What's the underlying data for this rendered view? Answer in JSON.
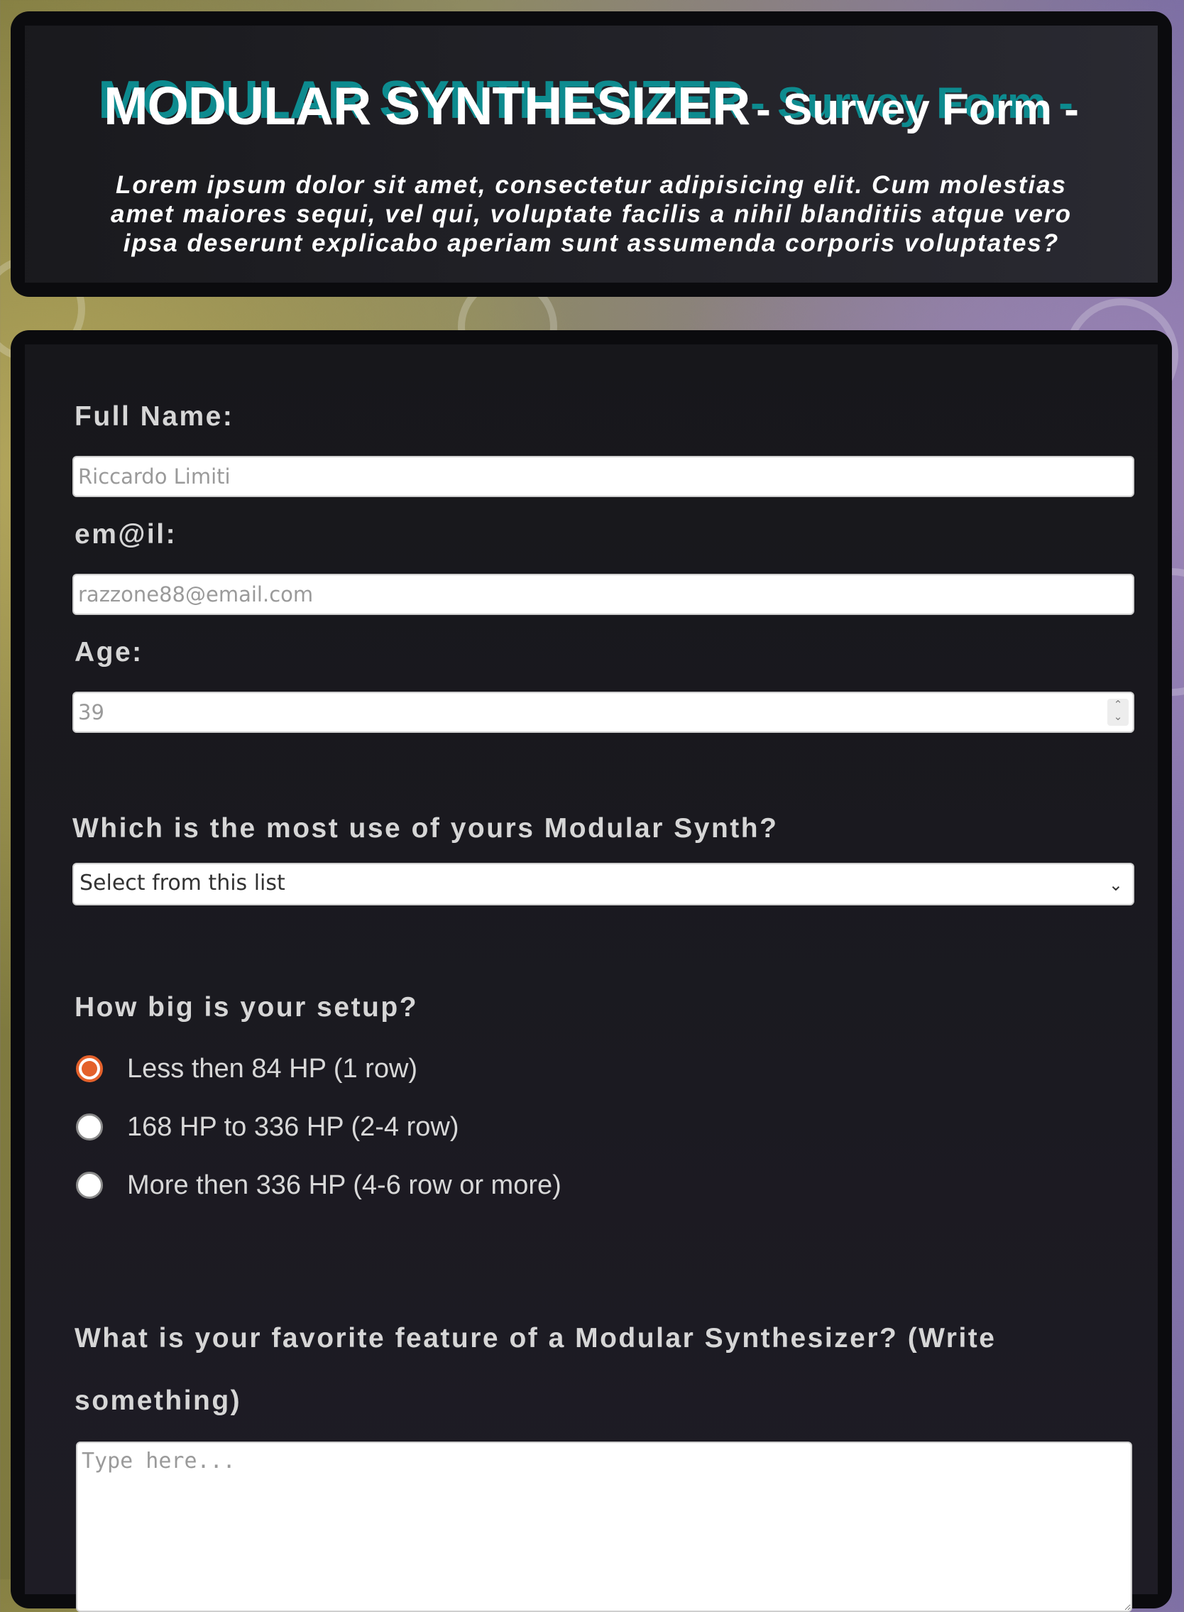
{
  "header": {
    "title_main": "MODULAR SYNTHESIZER",
    "title_sub": "- Survey Form -",
    "description": "Lorem ipsum dolor sit amet, consectetur adipisicing elit. Cum molestias amet maiores sequi, vel qui, voluptate facilis a nihil blanditiis atque vero ipsa deserunt explicabo aperiam sunt assumenda corporis voluptates?"
  },
  "form": {
    "name": {
      "label": "Full Name:",
      "placeholder": "Riccardo Limiti"
    },
    "email": {
      "label": "em@il:",
      "placeholder": "razzone88@email.com"
    },
    "age": {
      "label": "Age:",
      "placeholder": "39"
    },
    "use": {
      "label": "Which is the most use of yours Modular Synth?",
      "selected": "Select from this list"
    },
    "setup": {
      "label": "How big is your setup?",
      "options": [
        {
          "label": "Less then 84 HP (1 row)",
          "checked": true
        },
        {
          "label": "168 HP to 336 HP (2-4 row)",
          "checked": false
        },
        {
          "label": "More then 336 HP (4-6 row or more)",
          "checked": false
        }
      ]
    },
    "feature": {
      "label_line1": "What is your favorite feature of a Modular Synthesizer? (Write",
      "label_line2": "something)",
      "placeholder": "Type here..."
    }
  },
  "colors": {
    "accent_teal": "#0d8b8f",
    "radio_accent": "#e4612b",
    "card_bg": "#0b0b0e"
  }
}
